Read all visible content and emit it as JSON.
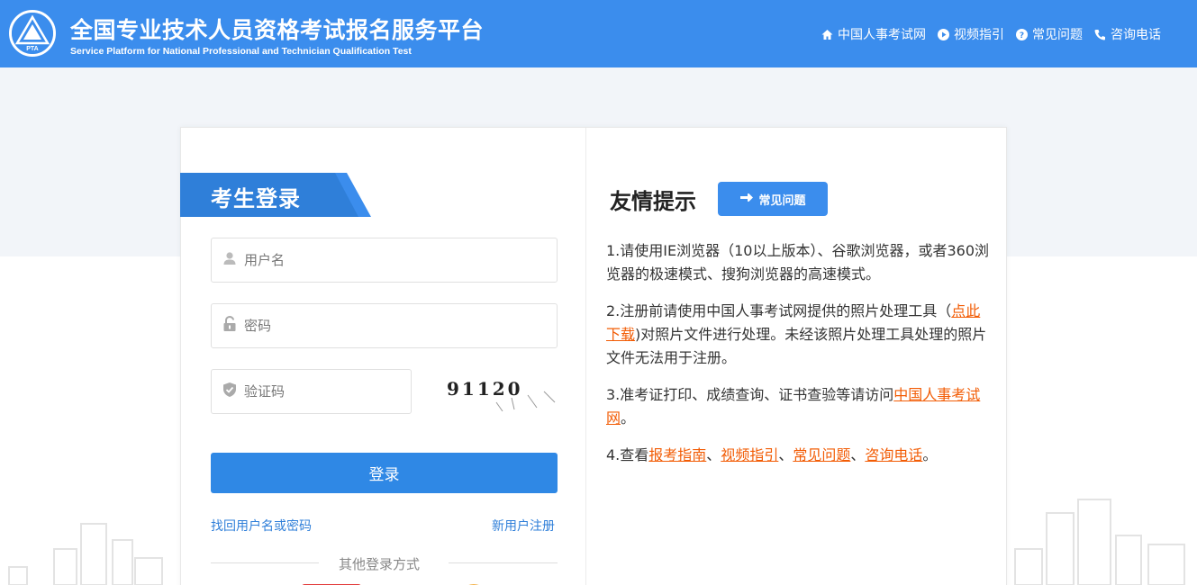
{
  "header": {
    "title_cn": "全国专业技术人员资格考试报名服务平台",
    "title_en": "Service Platform for National Professional and Technician Qualification Test",
    "logo_text": "PTA",
    "nav": [
      {
        "label": "中国人事考试网",
        "icon": "home-icon"
      },
      {
        "label": "视频指引",
        "icon": "play-icon"
      },
      {
        "label": "常见问题",
        "icon": "question-icon"
      },
      {
        "label": "咨询电话",
        "icon": "phone-icon"
      }
    ],
    "bg_color": "#3b8ded"
  },
  "login": {
    "title": "考生登录",
    "username_placeholder": "用户名",
    "password_placeholder": "密码",
    "captcha_placeholder": "验证码",
    "captcha_text": "91120",
    "login_button": "登录",
    "forget_link": "找回用户名或密码",
    "register_link": "新用户注册",
    "other_methods": "其他登录方式",
    "button_color": "#2f88e5"
  },
  "tips": {
    "title": "友情提示",
    "faq_badge": "常见问题",
    "item1": "1.请使用IE浏览器（10以上版本）、谷歌浏览器，或者360浏览器的极速模式、搜狗浏览器的高速模式。",
    "item2_before": "2.注册前请使用中国人事考试网提供的照片处理工具（",
    "item2_link": "点此下载",
    "item2_after": ")对照片文件进行处理。未经该照片处理工具处理的照片文件无法用于注册。",
    "item3_before": "3.准考证打印、成绩查询、证书查验等请访问",
    "item3_link": "中国人事考试网",
    "item3_after": "。",
    "item4_before": "4.查看",
    "item4_link1": "报考指南",
    "item4_sep1": "、",
    "item4_link2": "视频指引",
    "item4_sep2": "、",
    "item4_link3": "常见问题",
    "item4_sep3": "、",
    "item4_link4": "咨询电话",
    "item4_after": "。",
    "link_color": "#f25c05"
  }
}
